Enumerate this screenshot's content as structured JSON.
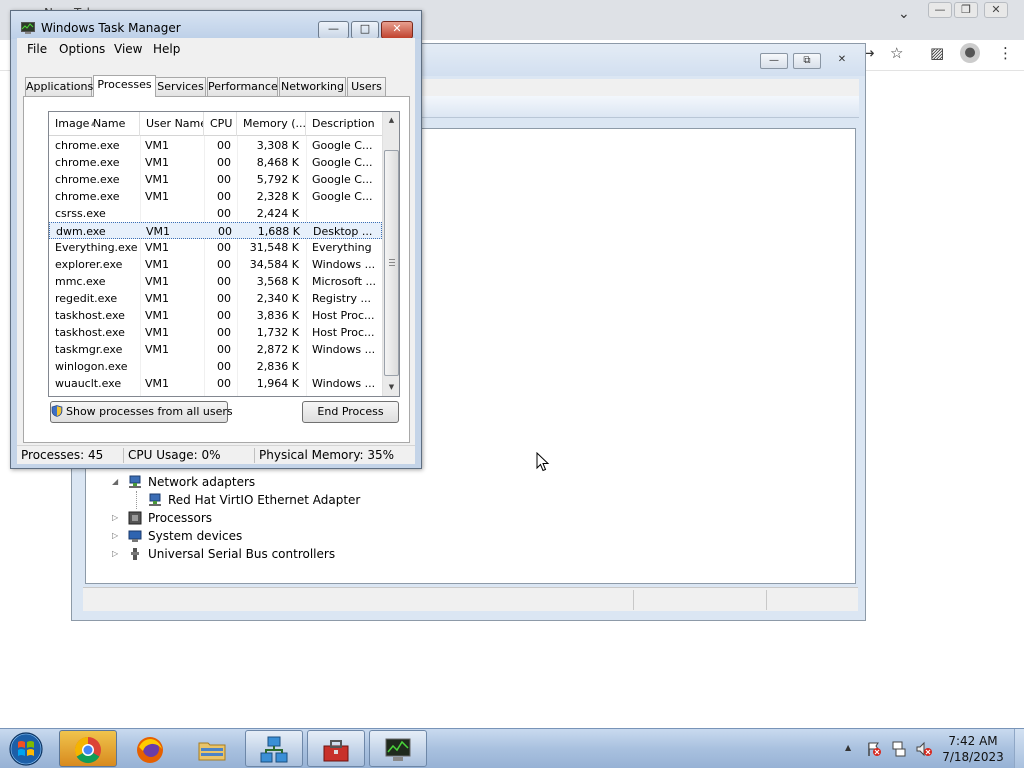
{
  "chrome": {
    "tab_title": "New Tab",
    "chevron_icon": "chevron-down-icon",
    "minimize_icon": "—",
    "restore_icon": "❐",
    "close_icon": "✕",
    "share_icon": "↪",
    "bookmark_icon": "☆",
    "sidepanel_icon": "▨",
    "profile_icon": "●",
    "menu_icon": "⋮"
  },
  "device_manager": {
    "minimize_icon": "—",
    "restore_icon": "⧉",
    "close_icon": "✕",
    "tree": [
      {
        "label": "Network adapters",
        "expander": "◢",
        "level": 0
      },
      {
        "label": "Red Hat VirtIO Ethernet Adapter",
        "expander": "",
        "level": 1
      },
      {
        "label": "Processors",
        "expander": "▷",
        "level": 0
      },
      {
        "label": "System devices",
        "expander": "▷",
        "level": 0
      },
      {
        "label": "Universal Serial Bus controllers",
        "expander": "▷",
        "level": 0
      }
    ]
  },
  "task_manager": {
    "title": "Windows Task Manager",
    "minimize_icon": "—",
    "maximize_icon": "□",
    "close_icon": "✕",
    "menu": [
      "File",
      "Options",
      "View",
      "Help"
    ],
    "tabs": [
      "Applications",
      "Processes",
      "Services",
      "Performance",
      "Networking",
      "Users"
    ],
    "active_tab": "Processes",
    "columns": [
      "Image Name",
      "User Name",
      "CPU",
      "Memory (...",
      "Description"
    ],
    "sort_arrow": "▲",
    "processes": [
      {
        "image": "chrome.exe",
        "user": "VM1",
        "cpu": "00",
        "memory": "3,308 K",
        "description": "Google C..."
      },
      {
        "image": "chrome.exe",
        "user": "VM1",
        "cpu": "00",
        "memory": "8,468 K",
        "description": "Google C..."
      },
      {
        "image": "chrome.exe",
        "user": "VM1",
        "cpu": "00",
        "memory": "5,792 K",
        "description": "Google C..."
      },
      {
        "image": "chrome.exe",
        "user": "VM1",
        "cpu": "00",
        "memory": "2,328 K",
        "description": "Google C..."
      },
      {
        "image": "csrss.exe",
        "user": "",
        "cpu": "00",
        "memory": "2,424 K",
        "description": ""
      },
      {
        "image": "dwm.exe",
        "user": "VM1",
        "cpu": "00",
        "memory": "1,688 K",
        "description": "Desktop ...",
        "selected": true
      },
      {
        "image": "Everything.exe",
        "user": "VM1",
        "cpu": "00",
        "memory": "31,548 K",
        "description": "Everything"
      },
      {
        "image": "explorer.exe",
        "user": "VM1",
        "cpu": "00",
        "memory": "34,584 K",
        "description": "Windows ..."
      },
      {
        "image": "mmc.exe",
        "user": "VM1",
        "cpu": "00",
        "memory": "3,568 K",
        "description": "Microsoft ..."
      },
      {
        "image": "regedit.exe",
        "user": "VM1",
        "cpu": "00",
        "memory": "2,340 K",
        "description": "Registry ..."
      },
      {
        "image": "taskhost.exe",
        "user": "VM1",
        "cpu": "00",
        "memory": "3,836 K",
        "description": "Host Proc..."
      },
      {
        "image": "taskhost.exe",
        "user": "VM1",
        "cpu": "00",
        "memory": "1,732 K",
        "description": "Host Proc..."
      },
      {
        "image": "taskmgr.exe",
        "user": "VM1",
        "cpu": "00",
        "memory": "2,872 K",
        "description": "Windows ..."
      },
      {
        "image": "winlogon.exe",
        "user": "",
        "cpu": "00",
        "memory": "2,836 K",
        "description": ""
      },
      {
        "image": "wuauclt.exe",
        "user": "VM1",
        "cpu": "00",
        "memory": "1,964 K",
        "description": "Windows ..."
      }
    ],
    "scroll_up_icon": "▲",
    "scroll_down_icon": "▼",
    "show_all_button": "Show processes from all users",
    "end_process_button": "End Process",
    "status": {
      "processes": "Processes: 45",
      "cpu": "CPU Usage: 0%",
      "memory": "Physical Memory: 35%"
    }
  },
  "taskbar": {
    "apps": [
      "Google Chrome",
      "Firefox",
      "Windows Explorer",
      "Network",
      "Toolbox",
      "Task Manager"
    ],
    "tray_arrow": "▲",
    "time": "7:42 AM",
    "date": "7/18/2023"
  }
}
